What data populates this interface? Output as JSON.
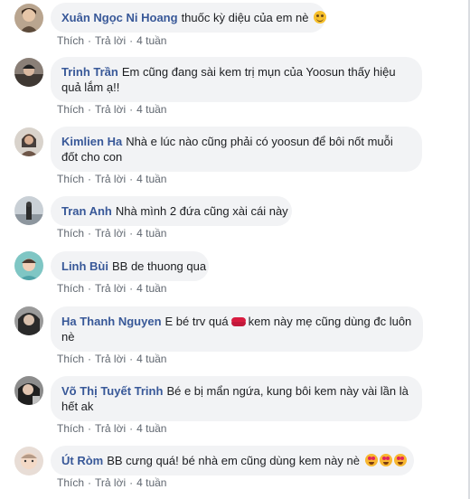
{
  "comments": [
    {
      "name": "Xuân Ngọc Ni Hoang",
      "text": "thuốc kỳ diệu của em nè",
      "emoji": "slightly-smiling-face",
      "like": "Thích",
      "reply": "Trả lời",
      "time": "4 tuần"
    },
    {
      "name": "Trinh Trần",
      "text": "Em cũng đang sài kem trị mụn của Yoosun thấy hiệu quả lắm ạ!!",
      "like": "Thích",
      "reply": "Trả lời",
      "time": "4 tuần"
    },
    {
      "name": "Kimlien Ha",
      "text": "Nhà e lúc nào cũng phải có yoosun để bôi nốt muỗi đốt cho con",
      "like": "Thích",
      "reply": "Trả lời",
      "time": "4 tuần"
    },
    {
      "name": "Tran Anh",
      "text": "Nhà mình 2 đứa cũng xài cái này",
      "like": "Thích",
      "reply": "Trả lời",
      "time": "4 tuần"
    },
    {
      "name": "Linh Bùi",
      "text": "BB de thuong qua",
      "like": "Thích",
      "reply": "Trả lời",
      "time": "4 tuần"
    },
    {
      "name": "Ha Thanh Nguyen",
      "text_before": "E bé trv quá",
      "emoji": "kiss-mark",
      "text_after": "kem này mẹ cũng dùng đc luôn nè",
      "like": "Thích",
      "reply": "Trả lời",
      "time": "4 tuần"
    },
    {
      "name": "Võ Thị Tuyết Trinh",
      "text": "Bé e bị mẩn ngứa, kung bôi kem này vài lần là hết ak",
      "like": "Thích",
      "reply": "Trả lời",
      "time": "4 tuần"
    },
    {
      "name": "Út Ròm",
      "text": "BB cưng quá! bé nhà em cũng dùng kem này nè",
      "emoji": "smiling-face-with-heart-eyes x3",
      "like": "Thích",
      "reply": "Trả lời",
      "time": "4 tuần"
    }
  ],
  "colors": {
    "name_link": "#385898",
    "bubble_bg": "#f2f3f5",
    "meta_text": "#606770"
  }
}
